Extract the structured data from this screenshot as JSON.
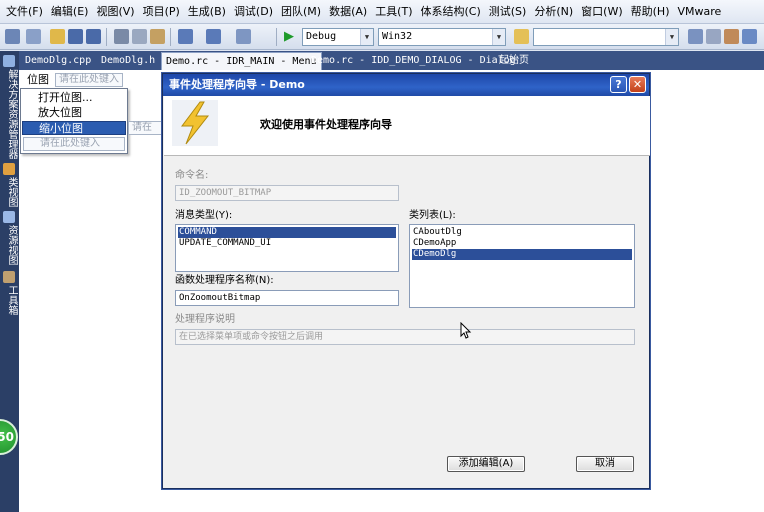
{
  "menubar": {
    "items": [
      "文件(F)",
      "编辑(E)",
      "视图(V)",
      "项目(P)",
      "生成(B)",
      "调试(D)",
      "团队(M)",
      "数据(A)",
      "工具(T)",
      "体系结构(C)",
      "测试(S)",
      "分析(N)",
      "窗口(W)",
      "帮助(H)",
      "VMware"
    ]
  },
  "toolbar": {
    "config": "Debug",
    "platform": "Win32",
    "find_value": ""
  },
  "doc_tabs": [
    "DemoDlg.cpp",
    "DemoDlg.h",
    "Demo.rc - IDR_MAIN - Menu",
    "Demo.rc - IDD_DEMO_DIALOG - Dialog",
    "起始页"
  ],
  "sidebar": {
    "items": [
      "解决方案资源管理器",
      "类视图",
      "资源视图",
      "工具箱"
    ],
    "badge": "50"
  },
  "menu_editor": {
    "top_item": "位图",
    "placeholder": "请在此处键入",
    "placeholder_side": "请在",
    "items": [
      "打开位图...",
      "放大位图",
      "缩小位图"
    ]
  },
  "dialog": {
    "title": "事件处理程序向导 - Demo",
    "help_label": "?",
    "close_label": "✕",
    "welcome": "欢迎使用事件处理程序向导",
    "command_label": "命令名:",
    "command_value": "ID_ZOOMOUT_BITMAP",
    "message_type_label": "消息类型(Y):",
    "message_types": [
      "COMMAND",
      "UPDATE_COMMAND_UI"
    ],
    "class_list_label": "类列表(L):",
    "classes": [
      "CAboutDlg",
      "CDemoApp",
      "CDemoDlg"
    ],
    "handler_label": "函数处理程序名称(N):",
    "handler_value": "OnZoomoutBitmap",
    "desc_label": "处理程序说明",
    "desc_value": "在已选择菜单项或命令按钮之后调用",
    "add_button": "添加编辑(A)",
    "cancel_button": "取消"
  },
  "colors": {
    "title_bar": "#2f63c8",
    "selection": "#2c4f99",
    "sidebar": "#2b3f66"
  }
}
